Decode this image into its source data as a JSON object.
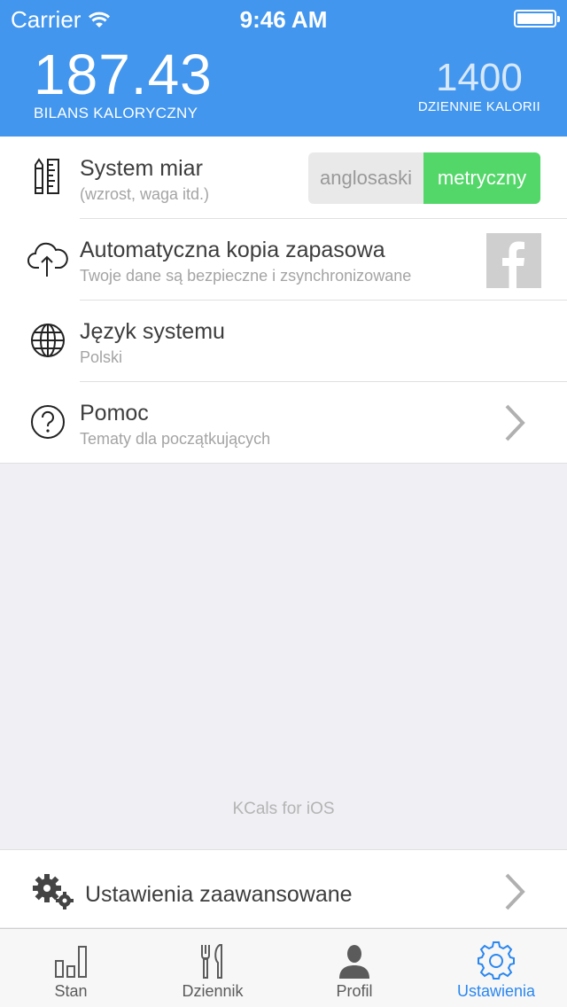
{
  "status_bar": {
    "carrier": "Carrier",
    "time": "9:46 AM"
  },
  "header": {
    "balance_value": "187.43",
    "balance_label": "BILANS KALORYCZNY",
    "daily_value": "1400",
    "daily_label": "DZIENNIE KALORII"
  },
  "settings": {
    "units": {
      "title": "System miar",
      "subtitle": "(wzrost, waga itd.)",
      "option_imperial": "anglosaski",
      "option_metric": "metryczny",
      "selected": "metryczny"
    },
    "backup": {
      "title": "Automatyczna kopia zapasowa",
      "subtitle": "Twoje dane są bezpieczne i zsynchronizowane",
      "service_icon": "facebook-icon"
    },
    "language": {
      "title": "Język systemu",
      "subtitle": "Polski"
    },
    "help": {
      "title": "Pomoc",
      "subtitle": "Tematy dla początkujących"
    }
  },
  "footer": {
    "app_credit": "KCals for iOS"
  },
  "advanced": {
    "title": "Ustawienia zaawansowane"
  },
  "tabbar": {
    "tabs": [
      {
        "label": "Stan",
        "icon": "bar-chart-icon"
      },
      {
        "label": "Dziennik",
        "icon": "fork-knife-icon"
      },
      {
        "label": "Profil",
        "icon": "person-icon"
      },
      {
        "label": "Ustawienia",
        "icon": "gear-icon"
      }
    ],
    "active": "Ustawienia"
  },
  "colors": {
    "header_blue": "#4296ee",
    "toggle_green": "#53d769",
    "tab_active": "#2a87f0"
  }
}
